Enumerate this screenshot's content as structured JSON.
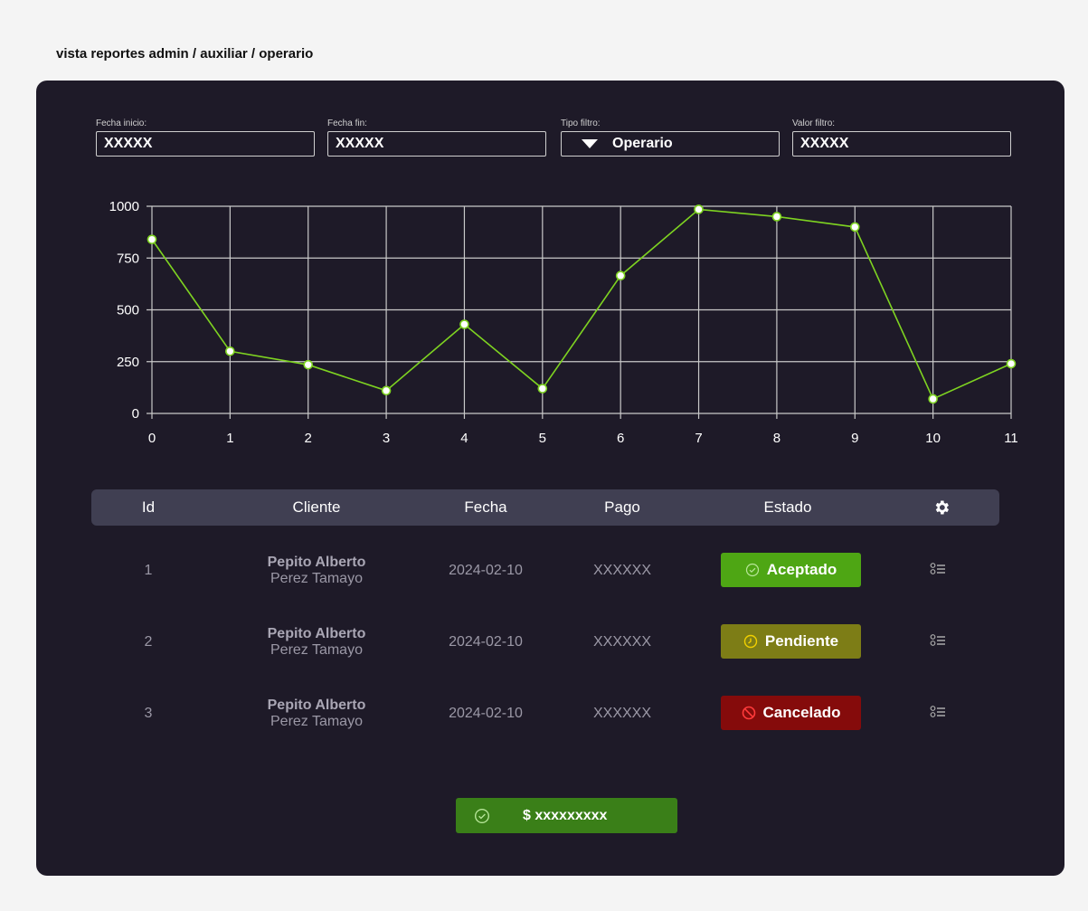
{
  "frame_title": "vista reportes admin / auxiliar / operario",
  "filters": [
    {
      "label": "Fecha inicio:",
      "value": "XXXXX"
    },
    {
      "label": "Fecha fin:",
      "value": "XXXXX"
    },
    {
      "label": "Tipo filtro:",
      "value": "Operario"
    },
    {
      "label": "Valor filtro:",
      "value": "XXXXX"
    }
  ],
  "chart_data": {
    "type": "line",
    "x": [
      0,
      1,
      2,
      3,
      4,
      5,
      6,
      7,
      8,
      9,
      10,
      11
    ],
    "values": [
      840,
      300,
      235,
      110,
      430,
      120,
      665,
      985,
      950,
      900,
      70,
      240
    ],
    "ylim": [
      0,
      1000
    ],
    "xlim": [
      0,
      11
    ],
    "yticks": [
      0,
      250,
      500,
      750,
      1000
    ],
    "grid": true,
    "line_color": "#7ed321"
  },
  "table": {
    "headers": [
      "Id",
      "Cliente",
      "Fecha",
      "Pago",
      "Estado"
    ],
    "settings_icon": "gear-icon",
    "rows": [
      {
        "id": "1",
        "name": "Pepito Alberto",
        "surname": "Perez Tamayo",
        "date": "2024-02-10",
        "payment": "XXXXXX",
        "status": "Aceptado",
        "status_color": "#4ea614",
        "status_icon": "check-circle-icon"
      },
      {
        "id": "2",
        "name": "Pepito Alberto",
        "surname": "Perez Tamayo",
        "date": "2024-02-10",
        "payment": "XXXXXX",
        "status": "Pendiente",
        "status_color": "#7d7d16",
        "status_icon": "clock-icon"
      },
      {
        "id": "3",
        "name": "Pepito Alberto",
        "surname": "Perez Tamayo",
        "date": "2024-02-10",
        "payment": "XXXXXX",
        "status": "Cancelado",
        "status_color": "#850b0b",
        "status_icon": "ban-icon"
      }
    ]
  },
  "total": {
    "label": "$ xxxxxxxxx",
    "icon": "check-circle-icon"
  }
}
